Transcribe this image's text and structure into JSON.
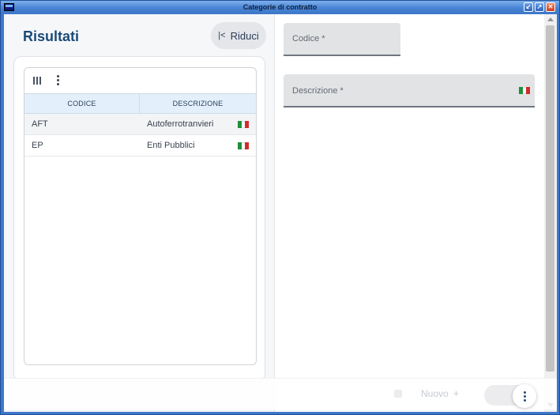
{
  "window": {
    "title": "Categorie di contratto",
    "buttons": [
      "minimize",
      "maximize",
      "close"
    ]
  },
  "left": {
    "title": "Risultati",
    "collapse_label": "Riduci",
    "grid": {
      "columns": [
        "CODICE",
        "DESCRIZIONE"
      ],
      "rows": [
        {
          "code": "AFT",
          "description": "Autoferrotranvieri",
          "flag": "it-flag-icon"
        },
        {
          "code": "EP",
          "description": "Enti Pubblici",
          "flag": "it-flag-icon"
        }
      ]
    }
  },
  "form": {
    "code_label": "Codice *",
    "description_label": "Descrizione *",
    "description_flag": "it-flag-icon"
  },
  "bottom": {
    "new_label": "Nuovo"
  },
  "colors": {
    "title": "#1a4a7a",
    "header_bg": "#e3f0fb",
    "titlebar": "#4a86d6"
  }
}
